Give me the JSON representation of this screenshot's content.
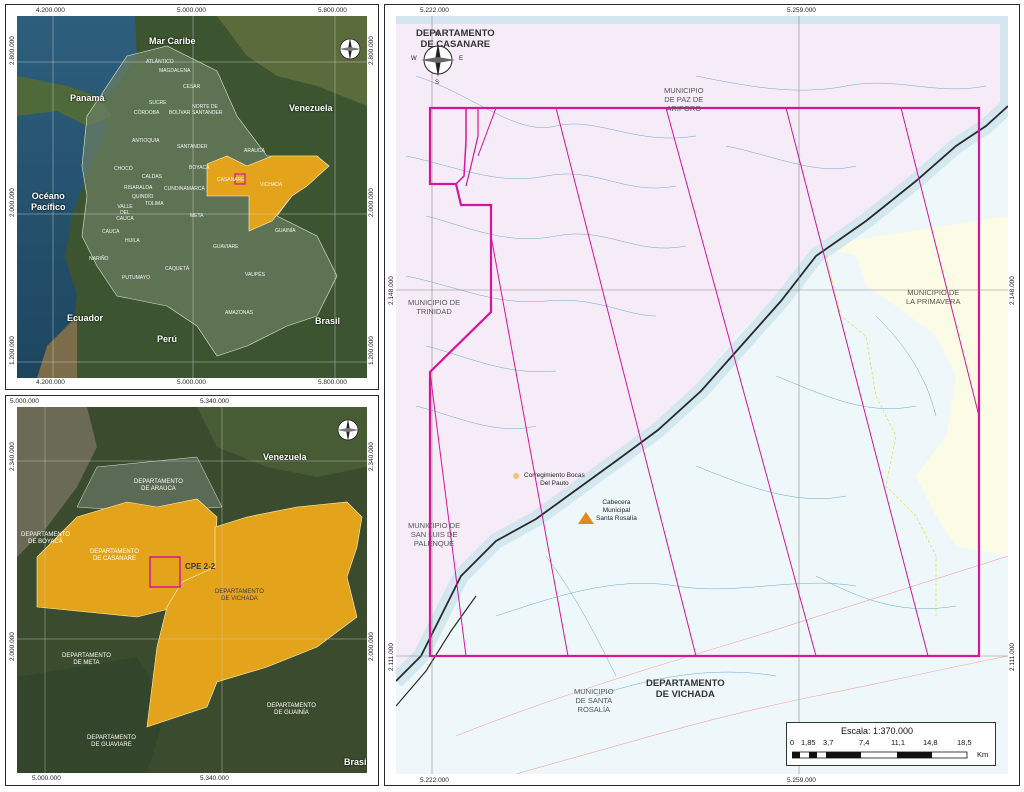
{
  "overview_map": {
    "labels": {
      "caribbean": "Mar Caribe",
      "panama": "Panamá",
      "venezuela": "Venezuela",
      "pacific": "Océano\nPacífico",
      "ecuador": "Ecuador",
      "peru": "Perú",
      "brasil": "Brasil"
    },
    "x_ticks_top": [
      "4.200.000",
      "5.000.000",
      "5.800.000"
    ],
    "x_ticks_bottom": [
      "4.200.000",
      "5.000.000",
      "5.800.000"
    ],
    "y_ticks": [
      "2.800.000",
      "2.000.000",
      "1.200.000"
    ],
    "departments": [
      "ATLÁNTICO",
      "MAGDALENA",
      "CESAR",
      "BOLÍVAR",
      "SUCRE",
      "CÓRDOBA",
      "NORTE DE SANTANDER",
      "ANTIOQUIA",
      "SANTANDER",
      "ARAUCA",
      "CHOCÓ",
      "BOYACÁ",
      "CASANARE",
      "VICHADA",
      "CALDAS",
      "RISARALDA",
      "QUINDÍO",
      "TOLIMA",
      "CUNDINAMARCA",
      "META",
      "VALLE DEL CAUCA",
      "CAUCA",
      "HUILA",
      "GUAINÍA",
      "GUAVIARE",
      "NARIÑO",
      "CAQUETÁ",
      "VAUPÉS",
      "PUTUMAYO",
      "AMAZONAS"
    ]
  },
  "regional_map": {
    "labels": {
      "venezuela": "Venezuela",
      "brasil": "Brasil",
      "arauca": "DEPARTAMENTO\nDE ARAUCA",
      "boyaca": "DEPARTAMENTO\nDE BOYACÁ",
      "casanare": "DEPARTAMENTO\nDE CASANARE",
      "vichada": "DEPARTAMENTO\nDE VICHADA",
      "meta": "DEPARTAMENTO\nDE META",
      "guainia": "DEPARTAMENTO\nDE GUAINÍA",
      "guaviare": "DEPARTAMENTO\nDE GUAVIARE",
      "block": "CPE 2-2"
    },
    "x_ticks_top": [
      "5.000.000",
      "5.340.000"
    ],
    "x_ticks_bottom": [
      "5.000.000",
      "5.340.000"
    ],
    "y_ticks": [
      "2.340.000",
      "2.000.000"
    ]
  },
  "main_map": {
    "x_ticks_top": [
      "5.222.000",
      "5.259.000"
    ],
    "x_ticks_bottom": [
      "5.222.000",
      "5.259.000"
    ],
    "y_ticks": [
      "2.148.000",
      "2.111.000"
    ],
    "labels": {
      "casanare_dept": "DEPARTAMENTO\nDE CASANARE",
      "vichada_dept": "DEPARTAMENTO\nDE VICHADA",
      "paz_de_ariporo": "MUNICIPIO\nDE PAZ DE\nARIPORO",
      "trinidad": "MUNICIPIO DE\nTRINIDAD",
      "la_primavera": "MUNICIPIO DE\nLA PRIMAVERA",
      "san_luis": "MUNICIPIO DE\nSAN LUIS DE\nPALENQUE",
      "santa_rosalia": "MUNICIPIO\nDE SANTA\nROSALÍA",
      "bocas_del_pauto": "Corregimiento Bocas\nDel Pauto",
      "cabecera": "Cabecera\nMunicipal\nSanta Rosalía"
    }
  },
  "north_arrow": {
    "n": "N",
    "s": "S",
    "e": "E",
    "w": "W"
  },
  "scale": {
    "title": "Escala: 1:370.000",
    "ticks": [
      "0",
      "1,85",
      "3,7",
      "7,4",
      "11,1",
      "14,8",
      "18,5"
    ],
    "unit": "Km"
  },
  "colors": {
    "department_fill": "#e3a41c",
    "block_outline": "#d6159b",
    "river": "#2a2a2a",
    "terrain_dark": "#34452a",
    "water": "#27546e"
  }
}
